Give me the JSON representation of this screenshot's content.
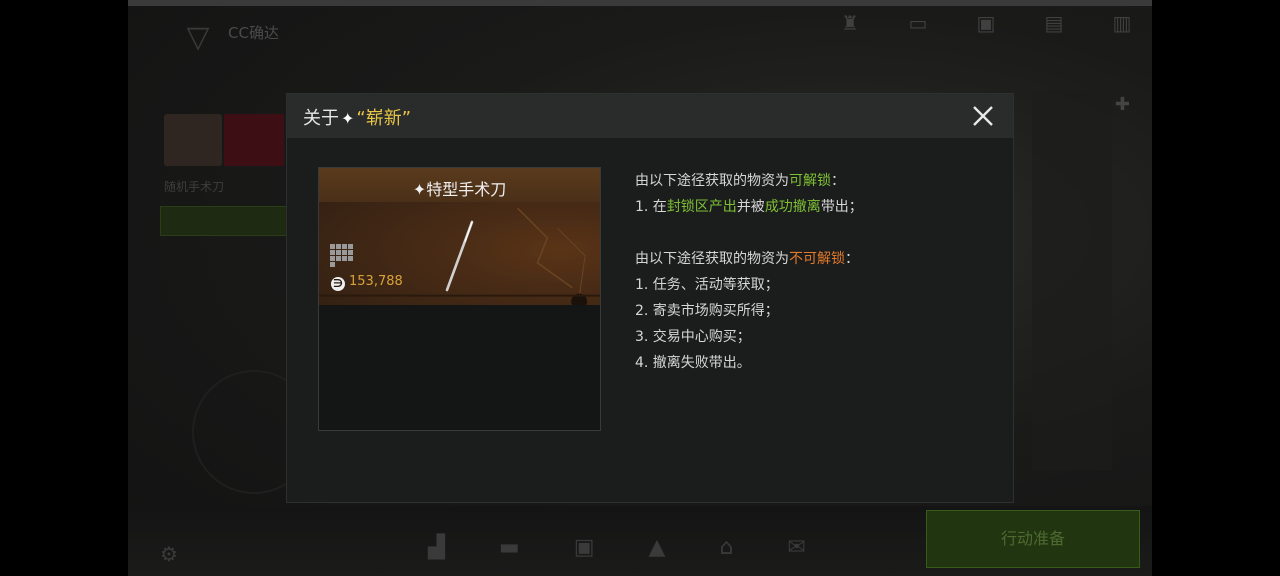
{
  "background": {
    "player_name": "CC确达",
    "nav_icons": [
      "",
      "",
      "",
      "",
      ""
    ],
    "item_name": "随机手术刀",
    "start_button": "行动准备"
  },
  "dialog": {
    "title_prefix": "关于",
    "title_quoted": "“崭新”",
    "close_icon": "close-icon",
    "item": {
      "name": "特型手术刀",
      "price": "153,788",
      "price_color": "#d8a23a"
    },
    "info": {
      "unlockable_header_pre": "由以下途径获取的物资为",
      "unlockable_word": "可解锁",
      "unlockable_header_post": "：",
      "unlockable_line_pre": "1. 在",
      "unlockable_line_zone": "封锁区产出",
      "unlockable_line_mid": "并被",
      "unlockable_line_success": "成功撤离",
      "unlockable_line_post": "带出；",
      "locked_header_pre": "由以下途径获取的物资为",
      "locked_word": "不可解锁",
      "locked_header_post": "：",
      "locked_items": [
        "1. 任务、活动等获取；",
        "2. 寄卖市场购买所得；",
        "3. 交易中心购买；",
        "4. 撤离失败带出。"
      ]
    },
    "accent_green": "#7ec035",
    "accent_orange": "#e07a2a",
    "accent_gold": "#e8c547"
  }
}
